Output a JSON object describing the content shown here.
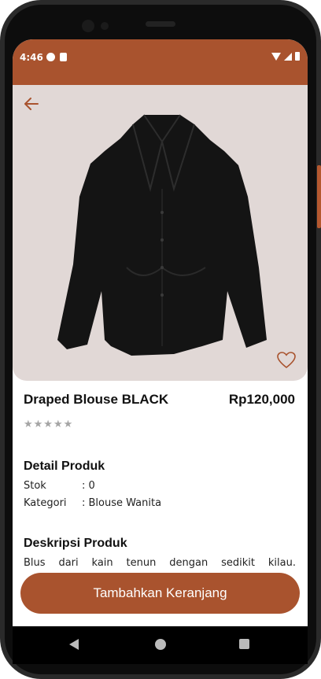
{
  "status_bar": {
    "time": "4:46"
  },
  "product": {
    "name": "Draped Blouse BLACK",
    "price": "Rp120,000",
    "rating_stars": "★★★★★"
  },
  "detail": {
    "heading": "Detail Produk",
    "stock_label": "Stok",
    "stock_value": ": 0",
    "category_label": "Kategori",
    "category_value": ": Blouse Wanita"
  },
  "description": {
    "heading": "Deskripsi Produk",
    "text": "Blus dari kain tenun dengan sedikit kilau."
  },
  "cta": {
    "label": "Tambahkan Keranjang"
  },
  "colors": {
    "accent": "#a9532e",
    "hero_bg": "#e1d8d6"
  },
  "icons": [
    "back-arrow-icon",
    "heart-icon",
    "nav-back-icon",
    "nav-home-icon",
    "nav-recent-icon"
  ]
}
